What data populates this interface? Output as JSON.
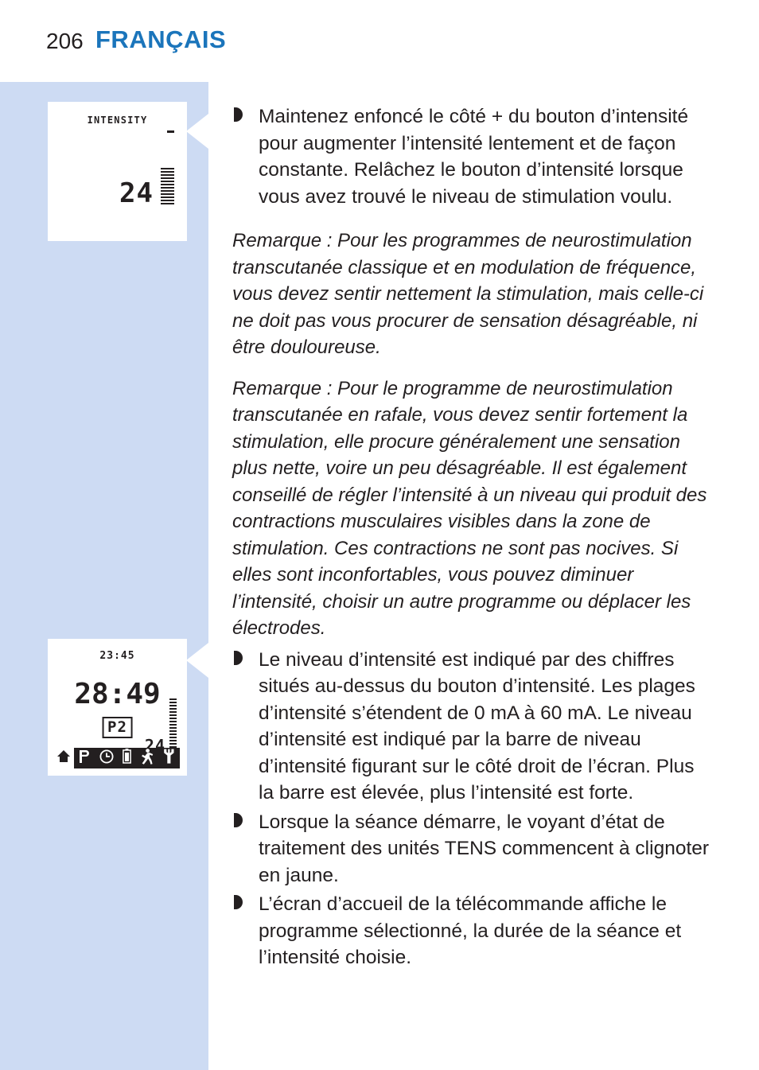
{
  "header": {
    "page_number": "206",
    "chapter_title": "FRANÇAIS",
    "title_color": "#1b75bb"
  },
  "colors": {
    "sidebar_band": "#cddbf3",
    "text": "#231f20",
    "accent": "#1b75bb"
  },
  "device_screens": [
    {
      "name": "intensity-screen",
      "label": "INTENSITY",
      "minus_sign": "-",
      "intensity_value": "24",
      "bar_level": "24"
    },
    {
      "name": "home-screen",
      "clock": "23:45",
      "session_time": "28:49",
      "program": "P2",
      "intensity_value": "24",
      "icons": [
        "home-icon",
        "program-p-icon",
        "clock-icon",
        "battery-icon",
        "walking-person-icon",
        "wrench-icon"
      ]
    }
  ],
  "content": {
    "bullet_1": "Maintenez enfoncé le côté + du bouton d’intensité pour augmenter l’intensité lentement et de façon constante. Relâchez le bouton d’intensité lorsque vous avez trouvé le niveau de stimulation voulu.",
    "note_1": "Remarque : Pour les programmes de neurostimulation transcutanée classique et en modulation de fréquence, vous devez sentir nettement la stimulation, mais celle-ci ne doit pas vous procurer de sensation désagréable, ni être douloureuse.",
    "note_2": "Remarque : Pour le programme de neurostimulation transcutanée en rafale, vous devez sentir fortement la stimulation, elle procure généralement une sensation plus nette, voire un peu désagréable. Il est également conseillé de régler l’intensité à un niveau qui produit des contractions musculaires visibles dans la zone de stimulation. Ces contractions ne sont pas nocives. Si elles sont inconfortables, vous pouvez diminuer l’intensité, choisir un autre programme ou déplacer les électrodes.",
    "bullet_2": "Le niveau d’intensité est indiqué par des chiffres situés au-dessus du bouton d’intensité. Les plages d’intensité s’étendent de 0 mA à 60 mA. Le niveau d’intensité est indiqué par la barre de niveau d’intensité figurant sur le côté droit de l’écran. Plus la barre est élevée, plus l’intensité est forte.",
    "bullet_3": "Lorsque la séance démarre, le voyant d’état de traitement des unités TENS commencent à clignoter en jaune.",
    "bullet_4": "L’écran d’accueil de la télécommande affiche le programme sélectionné, la durée de la séance et l’intensité choisie."
  }
}
